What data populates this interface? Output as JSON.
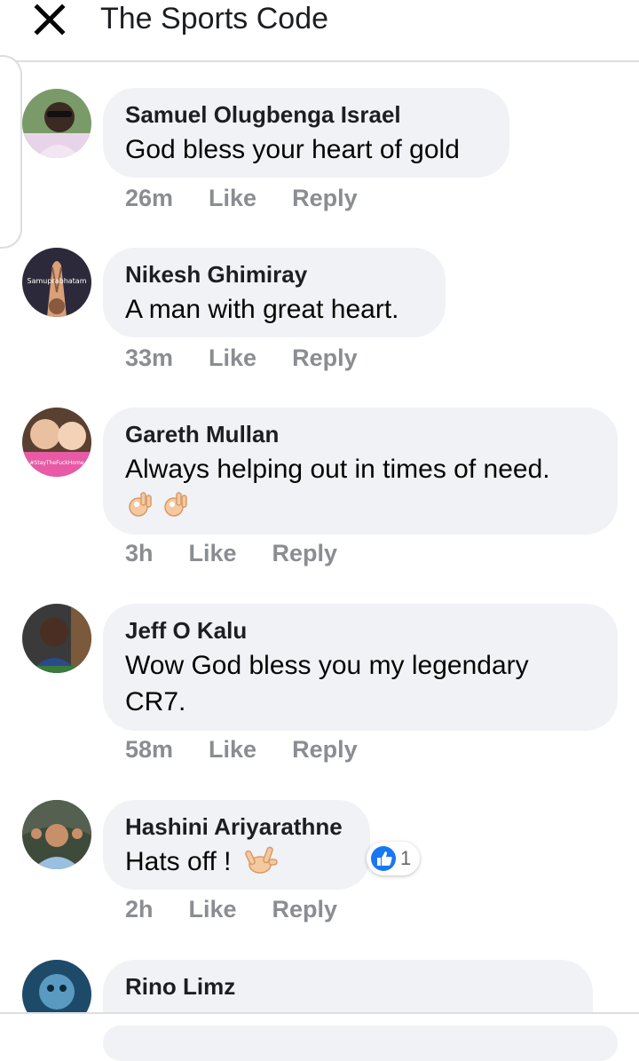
{
  "header": {
    "title": "The Sports Code"
  },
  "actions": {
    "like": "Like",
    "reply": "Reply"
  },
  "comments": [
    {
      "author": "Samuel Olugbenga Israel",
      "text": "God bless your heart of gold",
      "time": "26m"
    },
    {
      "author": "Nikesh Ghimiray",
      "text": "A man with great heart.",
      "time": "33m",
      "avatar_text": "Samuprabhatam"
    },
    {
      "author": "Gareth Mullan",
      "text": "Always helping out in times of need.",
      "emoji": [
        "ok-hand",
        "ok-hand"
      ],
      "time": "3h",
      "avatar_text": "#StayTheFuckHome"
    },
    {
      "author": "Jeff O Kalu",
      "text_lines": [
        "Wow God bless you my legendary",
        "CR7."
      ],
      "time": "58m"
    },
    {
      "author": "Hashini Ariyarathne",
      "text": "Hats off !",
      "emoji": [
        "love-you-gesture"
      ],
      "time": "2h",
      "reaction": {
        "icon": "thumbs-up-icon",
        "count": "1"
      }
    },
    {
      "author": "Rino Limz",
      "text": ""
    }
  ],
  "colors": {
    "bubble": "#f0f2f5",
    "meta": "#8a8d91",
    "like_blue": "#1877f2"
  }
}
